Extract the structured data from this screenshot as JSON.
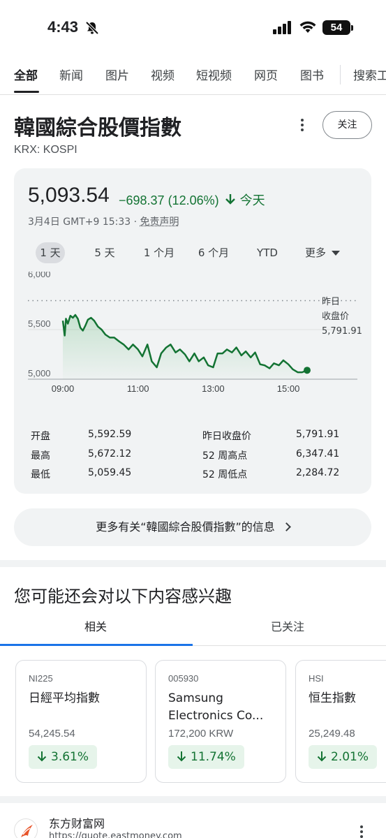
{
  "status_bar": {
    "time": "4:43",
    "battery": "54"
  },
  "tabs": [
    "全部",
    "新闻",
    "图片",
    "视频",
    "短视频",
    "网页",
    "图书",
    "搜索工具"
  ],
  "header": {
    "title": "韓國綜合股價指數",
    "subtitle": "KRX: KOSPI",
    "follow_label": "关注"
  },
  "quote": {
    "price": "5,093.54",
    "change": "−698.37 (12.06%)",
    "change_suffix": "今天",
    "timestamp": "3月4日 GMT+9 15:33 · ",
    "disclaimer": "免责声明",
    "down_color": "#137333"
  },
  "ranges": [
    "1 天",
    "5 天",
    "1 个月",
    "6 个月",
    "YTD",
    "更多"
  ],
  "prev_close_label": [
    "昨日",
    "收盘价",
    "5,791.91"
  ],
  "chart_data": {
    "type": "area",
    "xlabel": "",
    "ylabel": "",
    "x_ticks": [
      "09:00",
      "11:00",
      "13:00",
      "15:00"
    ],
    "y_ticks": [
      "6,000",
      "5,500",
      "5,000"
    ],
    "ylim": [
      5000,
      6000
    ],
    "xlim": [
      540,
      930
    ],
    "prev_close": 5791.91,
    "grid": true,
    "series": [
      {
        "x": [
          540,
          543,
          545,
          548,
          552,
          556,
          560,
          564,
          568,
          572,
          576,
          580,
          585,
          590,
          596,
          602,
          608,
          615,
          622,
          630,
          637,
          645,
          652,
          660,
          667,
          675,
          682,
          690,
          697,
          705,
          712,
          720,
          727,
          735,
          742,
          750,
          757,
          765,
          772,
          780,
          787,
          795,
          802,
          810,
          817,
          825,
          832,
          840,
          847,
          855,
          862,
          870,
          877,
          885,
          892,
          900,
          907,
          915,
          922,
          930
        ],
        "values": [
          5590,
          5440,
          5610,
          5560,
          5640,
          5620,
          5648,
          5610,
          5520,
          5490,
          5540,
          5600,
          5620,
          5590,
          5530,
          5500,
          5450,
          5420,
          5420,
          5380,
          5350,
          5300,
          5350,
          5300,
          5230,
          5350,
          5180,
          5120,
          5260,
          5320,
          5350,
          5270,
          5300,
          5250,
          5180,
          5260,
          5180,
          5220,
          5140,
          5120,
          5260,
          5260,
          5300,
          5270,
          5320,
          5240,
          5280,
          5220,
          5270,
          5150,
          5140,
          5110,
          5160,
          5140,
          5190,
          5150,
          5100,
          5070,
          5070,
          5090
        ]
      }
    ]
  },
  "stats": [
    {
      "label": "开盘",
      "value": "5,592.59"
    },
    {
      "label": "最高",
      "value": "5,672.12"
    },
    {
      "label": "最低",
      "value": "5,059.45"
    },
    {
      "label": "昨日收盘价",
      "value": "5,791.91"
    },
    {
      "label": "52 周高点",
      "value": "6,347.41"
    },
    {
      "label": "52 周低点",
      "value": "2,284.72"
    }
  ],
  "more_info": "更多有关“韓國綜合股價指數”的信息",
  "interest": {
    "heading": "您可能还会对以下内容感兴趣",
    "tabs": [
      "相关",
      "已关注"
    ],
    "cards": [
      {
        "symbol": "NI225",
        "name": "日經平均指數",
        "value": "54,245.54",
        "change": "3.61%"
      },
      {
        "symbol": "005930",
        "name": "Samsung Electronics Co...",
        "value": "172,200 KRW",
        "change": "11.74%"
      },
      {
        "symbol": "HSI",
        "name": "恒生指數",
        "value": "25,249.48",
        "change": "2.01%"
      }
    ]
  },
  "source": {
    "name": "东方财富网",
    "url": "https://quote.eastmoney.com"
  }
}
